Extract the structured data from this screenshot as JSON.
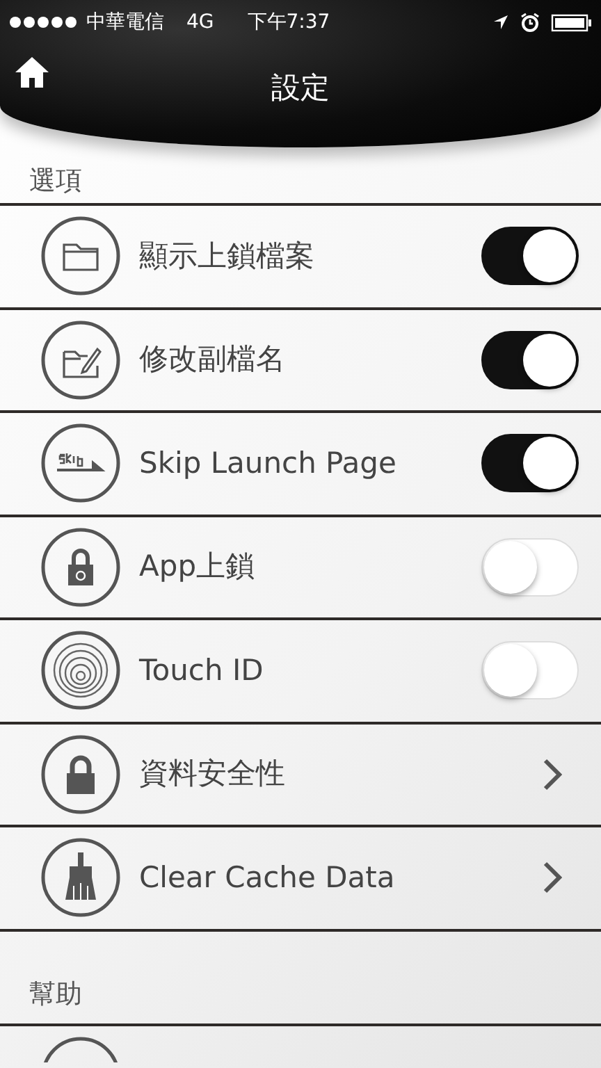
{
  "status_bar": {
    "carrier": "中華電信",
    "network": "4G",
    "time": "下午7:37"
  },
  "header": {
    "title": "設定"
  },
  "sections": [
    {
      "title": "選項",
      "items": [
        {
          "label": "顯示上鎖檔案",
          "kind": "toggle",
          "on": true
        },
        {
          "label": "修改副檔名",
          "kind": "toggle",
          "on": true
        },
        {
          "label": "Skip Launch Page",
          "kind": "toggle",
          "on": true
        },
        {
          "label": "App上鎖",
          "kind": "toggle",
          "on": false
        },
        {
          "label": "Touch ID",
          "kind": "toggle",
          "on": false
        },
        {
          "label": "資料安全性",
          "kind": "link"
        },
        {
          "label": "Clear Cache Data",
          "kind": "link"
        }
      ]
    },
    {
      "title": "幫助"
    }
  ]
}
